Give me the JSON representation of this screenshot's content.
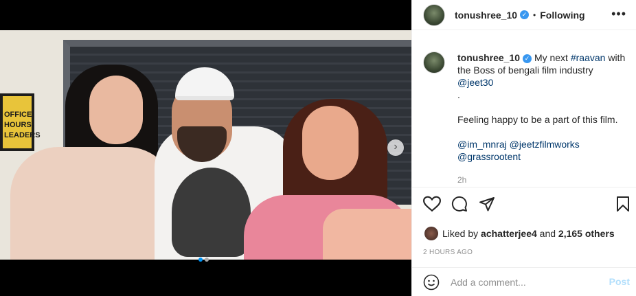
{
  "post": {
    "username": "tonushree_10",
    "follow_status": "Following",
    "bullet": "•",
    "more": "•••",
    "verified_mark": "✓"
  },
  "caption": {
    "username": "tonushree_10",
    "text_1": "My next ",
    "hashtag": "#raavan",
    "text_2": " with the Boss of bengali film industry ",
    "mention_1": "@jeet30",
    "text_3": " .",
    "line_2": "Feeling happy to be a part of this film.",
    "mention_2": "@im_mnraj",
    "mention_3": "@jeetzfilmworks",
    "mention_4": "@grassrootent",
    "time": "2h"
  },
  "photo": {
    "frame_text": "OFFICE HOURS LEADERS",
    "next": "›"
  },
  "likes": {
    "prefix": "Liked by ",
    "user": "achatterjee4",
    "and": " and ",
    "others": "2,165 others"
  },
  "timestamp": "2 HOURS AGO",
  "comment": {
    "placeholder": "Add a comment...",
    "post_label": "Post"
  },
  "icons": [
    "heart-icon",
    "comment-icon",
    "share-icon",
    "bookmark-icon",
    "emoji-icon",
    "more-icon",
    "chevron-right-icon"
  ],
  "colors": {
    "link": "#00376b",
    "verified": "#3897f0",
    "post_disabled": "#b2dffc"
  }
}
